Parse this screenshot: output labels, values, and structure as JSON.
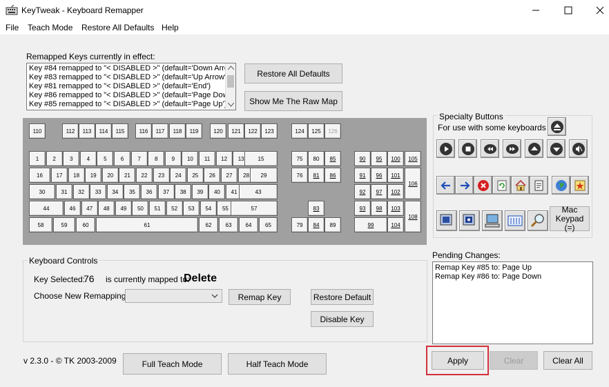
{
  "window": {
    "title": "KeyTweak -  Keyboard Remapper"
  },
  "menu": [
    "File",
    "Teach Mode",
    "Restore All Defaults",
    "Help"
  ],
  "remapped": {
    "label": "Remapped Keys currently in effect:",
    "items": [
      "Key #84 remapped to \"< DISABLED >\" (default='Down Arrow')",
      "Key #83 remapped to \"< DISABLED >\" (default='Up Arrow')",
      "Key #81 remapped to \"< DISABLED >\" (default='End')",
      "Key #86 remapped to \"< DISABLED >\" (default='Page Down')",
      "Key #85 remapped to \"< DISABLED >\" (default='Page Up')"
    ]
  },
  "top_buttons": {
    "restore_all": "Restore All Defaults",
    "raw_map": "Show Me The Raw Map"
  },
  "keyboard": {
    "row_fn": [
      "110",
      "112",
      "113",
      "114",
      "115",
      "116",
      "117",
      "118",
      "119",
      "120",
      "121",
      "122",
      "123",
      "124",
      "125",
      "126"
    ],
    "row1": [
      "1",
      "2",
      "3",
      "4",
      "5",
      "6",
      "7",
      "8",
      "9",
      "10",
      "11",
      "12",
      "13",
      "15"
    ],
    "row2": [
      "16",
      "17",
      "18",
      "19",
      "20",
      "21",
      "22",
      "23",
      "24",
      "25",
      "26",
      "27",
      "28",
      "29"
    ],
    "row3": [
      "30",
      "31",
      "32",
      "33",
      "34",
      "35",
      "36",
      "37",
      "38",
      "39",
      "40",
      "41",
      "43"
    ],
    "row4": [
      "44",
      "46",
      "47",
      "48",
      "49",
      "50",
      "51",
      "52",
      "53",
      "54",
      "55",
      "57"
    ],
    "row5": [
      "58",
      "59",
      "60",
      "61",
      "62",
      "63",
      "64",
      "65"
    ],
    "nav": [
      "75",
      "80",
      "85",
      "76",
      "81",
      "86",
      "83",
      "79",
      "84",
      "89"
    ],
    "numpad": [
      "90",
      "95",
      "100",
      "105",
      "91",
      "96",
      "101",
      "106",
      "92",
      "97",
      "102",
      "93",
      "98",
      "103",
      "108",
      "99",
      "104"
    ]
  },
  "specialty": {
    "title": "Specialty Buttons",
    "subtitle": "For use with some keyboards",
    "mac_keypad": "Mac\nKeypad (=)"
  },
  "controls": {
    "group_title": "Keyboard Controls",
    "key_selected_label": "Key Selected:",
    "key_selected_value": "76",
    "mapped_to_label": "is currently mapped to:",
    "mapped_to_value": "Delete",
    "choose_label": "Choose New Remapping",
    "remap_key": "Remap Key",
    "restore_default": "Restore Default",
    "disable_key": "Disable Key"
  },
  "pending": {
    "label": "Pending Changes:",
    "items": [
      "Remap Key #85 to: Page Up",
      "Remap Key #86 to: Page Down"
    ]
  },
  "footer": {
    "version": "v 2.3.0 - © TK 2003-2009",
    "full_teach": "Full Teach Mode",
    "half_teach": "Half Teach Mode",
    "apply": "Apply",
    "clear": "Clear",
    "clear_all": "Clear All"
  },
  "colors": {
    "highlight": "#d32f3a",
    "keyboard_bg": "#a0a0a0"
  }
}
